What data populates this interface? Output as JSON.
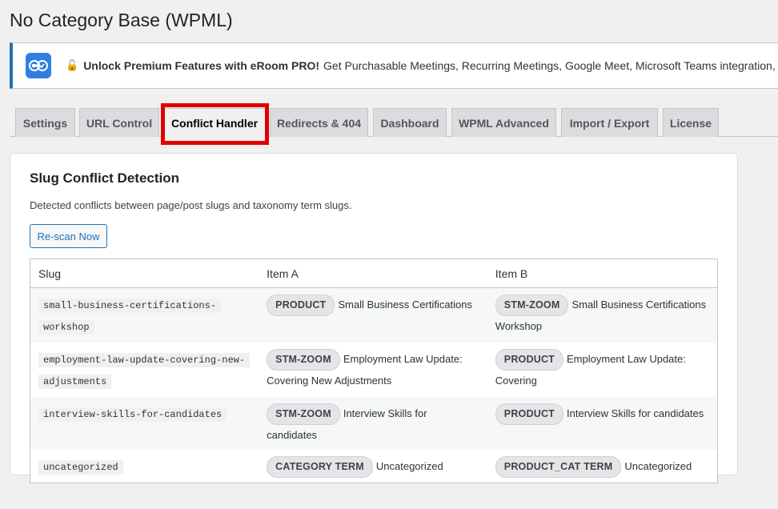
{
  "page": {
    "title": "No Category Base (WPML)"
  },
  "notice": {
    "lock_icon": "🔓",
    "strong": "Unlock Premium Features with eRoom PRO!",
    "text": "Get Purchasable Meetings, Recurring Meetings, Google Meet, Microsoft Teams integration, and"
  },
  "tabs": [
    {
      "label": "Settings"
    },
    {
      "label": "URL Control"
    },
    {
      "label": "Conflict Handler",
      "active": true
    },
    {
      "label": "Redirects & 404"
    },
    {
      "label": "Dashboard"
    },
    {
      "label": "WPML Advanced"
    },
    {
      "label": "Import / Export"
    },
    {
      "label": "License"
    }
  ],
  "card": {
    "title": "Slug Conflict Detection",
    "description": "Detected conflicts between page/post slugs and taxonomy term slugs.",
    "rescan_label": "Re-scan Now"
  },
  "table": {
    "headers": [
      "Slug",
      "Item A",
      "Item B"
    ],
    "rows": [
      {
        "slug": "small-business-certifications-workshop",
        "a_badge": "PRODUCT",
        "a_text": "Small Business Certifications",
        "b_badge": "STM-ZOOM",
        "b_text": "Small Business Certifications Workshop"
      },
      {
        "slug": "employment-law-update-covering-new-adjustments",
        "a_badge": "STM-ZOOM",
        "a_text": "Employment Law Update: Covering New Adjustments",
        "b_badge": "PRODUCT",
        "b_text": "Employment Law Update: Covering"
      },
      {
        "slug": "interview-skills-for-candidates",
        "a_badge": "STM-ZOOM",
        "a_text": "Interview Skills for candidates",
        "b_badge": "PRODUCT",
        "b_text": "Interview Skills for candidates"
      },
      {
        "slug": "uncategorized",
        "a_badge": "CATEGORY TERM",
        "a_text": "Uncategorized",
        "b_badge": "PRODUCT_CAT TERM",
        "b_text": "Uncategorized"
      }
    ]
  },
  "colors": {
    "accent": "#2271b1",
    "highlight": "#e00000",
    "logo_bg": "#2f7fe3"
  }
}
